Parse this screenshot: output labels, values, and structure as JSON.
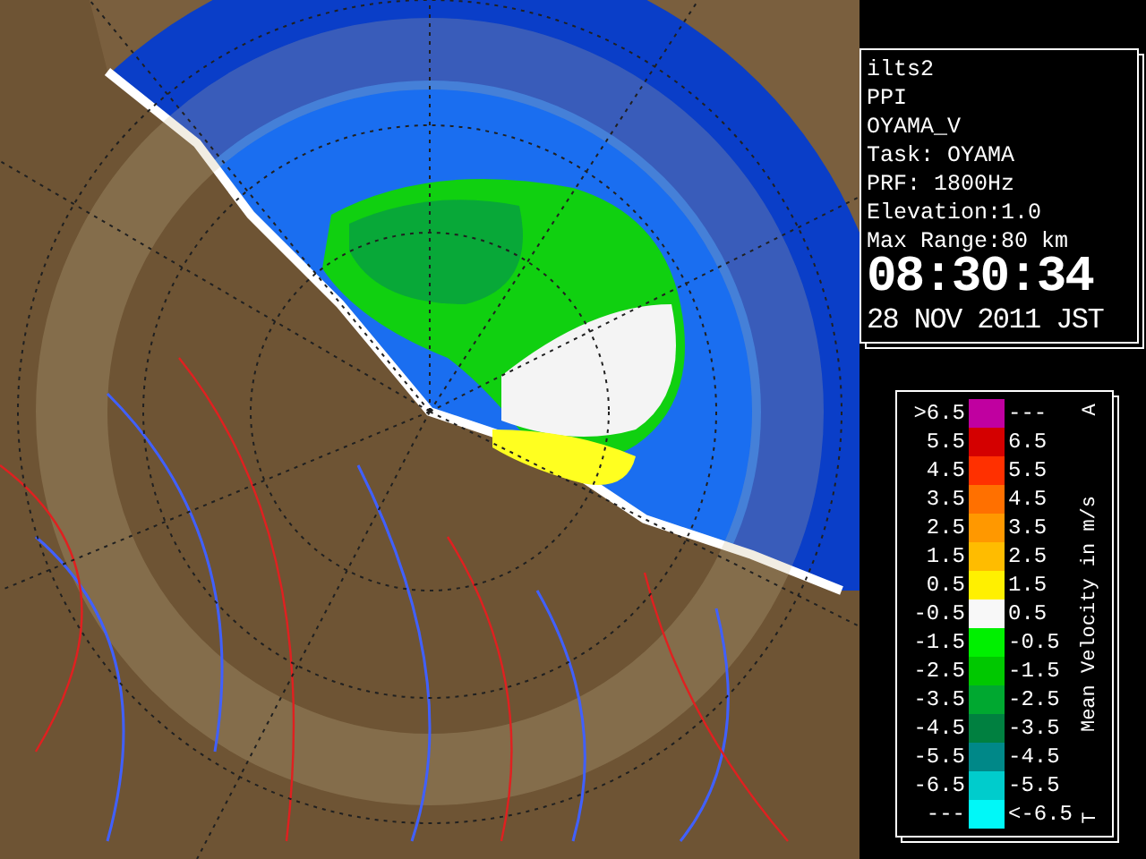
{
  "info": {
    "lines": [
      "ilts2",
      "PPI",
      "OYAMA_V",
      "Task: OYAMA",
      "PRF: 1800Hz",
      "Elevation:1.0",
      "Max Range:80 km"
    ],
    "time": "08:30:34",
    "date": "28 NOV 2011 JST"
  },
  "legend": {
    "title": "Mean Velocity in m/s",
    "top_mark": "A",
    "bottom_mark": "T",
    "rows": [
      {
        "low": ">6.5",
        "high": "---",
        "color": "#c000a0"
      },
      {
        "low": "5.5",
        "high": "6.5",
        "color": "#d40000"
      },
      {
        "low": "4.5",
        "high": "5.5",
        "color": "#ff3000"
      },
      {
        "low": "3.5",
        "high": "4.5",
        "color": "#ff7000"
      },
      {
        "low": "2.5",
        "high": "3.5",
        "color": "#ff9800"
      },
      {
        "low": "1.5",
        "high": "2.5",
        "color": "#ffbc00"
      },
      {
        "low": "0.5",
        "high": "1.5",
        "color": "#fff000"
      },
      {
        "low": "-0.5",
        "high": "0.5",
        "color": "#f8f8f8"
      },
      {
        "low": "-1.5",
        "high": "-0.5",
        "color": "#00f000"
      },
      {
        "low": "-2.5",
        "high": "-1.5",
        "color": "#00c800"
      },
      {
        "low": "-3.5",
        "high": "-2.5",
        "color": "#00a830"
      },
      {
        "low": "-4.5",
        "high": "-3.5",
        "color": "#008040"
      },
      {
        "low": "-5.5",
        "high": "-4.5",
        "color": "#008888"
      },
      {
        "low": "-6.5",
        "high": "-5.5",
        "color": "#00cccc"
      },
      {
        "low": "---",
        "high": "<-6.5",
        "color": "#00f8f8"
      }
    ]
  }
}
